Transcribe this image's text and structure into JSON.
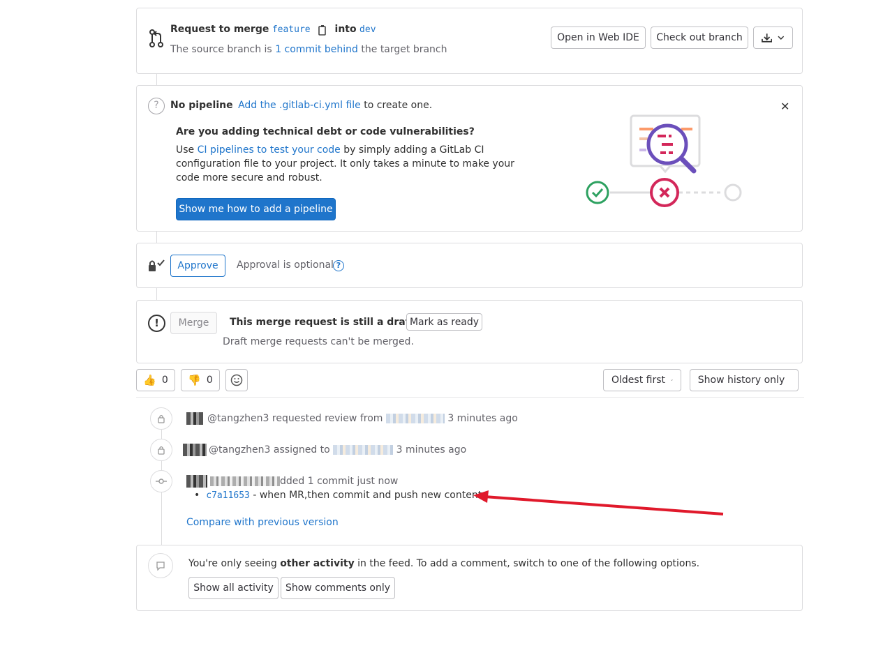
{
  "merge_header": {
    "request_label": "Request to merge",
    "source_branch": "feature",
    "into_label": "into",
    "target_branch": "dev",
    "status_prefix": "The source branch is",
    "status_link": "1 commit behind",
    "status_suffix": "the target branch",
    "open_web_ide": "Open in Web IDE",
    "checkout_branch": "Check out branch"
  },
  "pipeline": {
    "title": "No pipeline",
    "add_link": "Add the .gitlab-ci.yml file",
    "suffix": "to create one.",
    "heading": "Are you adding technical debt or code vulnerabilities?",
    "body_prefix": "Use",
    "body_link": "CI pipelines to test your code",
    "body_line1_suffix": "by simply adding a GitLab CI",
    "body_line2": "configuration file to your project. It only takes a minute to make your",
    "body_line3": "code more secure and robust.",
    "button": "Show me how to add a pipeline"
  },
  "approval": {
    "button": "Approve",
    "text": "Approval is optional"
  },
  "merge": {
    "button": "Merge",
    "draft_text": "This merge request is still a draft.",
    "mark_ready": "Mark as ready",
    "cannot_merge": "Draft merge requests can't be merged."
  },
  "reactions": {
    "thumbs_up": "👍",
    "thumbs_up_count": "0",
    "thumbs_down": "👎",
    "thumbs_down_count": "0",
    "sort": "Oldest first",
    "filter": "Show history only"
  },
  "activity": [
    {
      "user": "@tangzhen3",
      "action": "requested review from",
      "time": "3 minutes ago"
    },
    {
      "user": "@tangzhen3",
      "action": "assigned to",
      "time": "3 minutes ago"
    },
    {
      "action": "dded 1 commit just now"
    }
  ],
  "commit": {
    "sha": "c7a11653",
    "message": "- when MR,then commit and push new content",
    "compare_link": "Compare with previous version"
  },
  "feed_notice": {
    "prefix": "You're only seeing",
    "bold": "other activity",
    "suffix": "in the feed. To add a comment, switch to one of the following options.",
    "show_all": "Show all activity",
    "show_comments": "Show comments only"
  },
  "colors": {
    "link": "#1f75cb",
    "success": "#108548",
    "danger": "#dd2b0e",
    "annotation_arrow": "#e0192b"
  }
}
